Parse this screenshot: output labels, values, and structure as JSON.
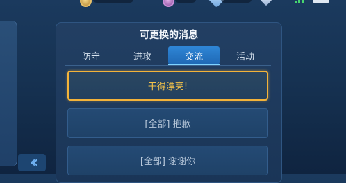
{
  "panel": {
    "title": "可更换的消息",
    "tabs": [
      {
        "label": "防守",
        "active": false
      },
      {
        "label": "进攻",
        "active": false
      },
      {
        "label": "交流",
        "active": true
      },
      {
        "label": "活动",
        "active": false
      }
    ],
    "messages": [
      {
        "label": "干得漂亮!",
        "selected": true
      },
      {
        "label": "[全部] 抱歉",
        "selected": false
      },
      {
        "label": "[全部] 谢谢你",
        "selected": false
      }
    ]
  },
  "sidebar": {
    "collapse_icon": "double-chevron-left-icon"
  },
  "colors": {
    "accent": "#1e68b4",
    "selected_border": "#f3b33a",
    "selected_text": "#f4c34a"
  }
}
